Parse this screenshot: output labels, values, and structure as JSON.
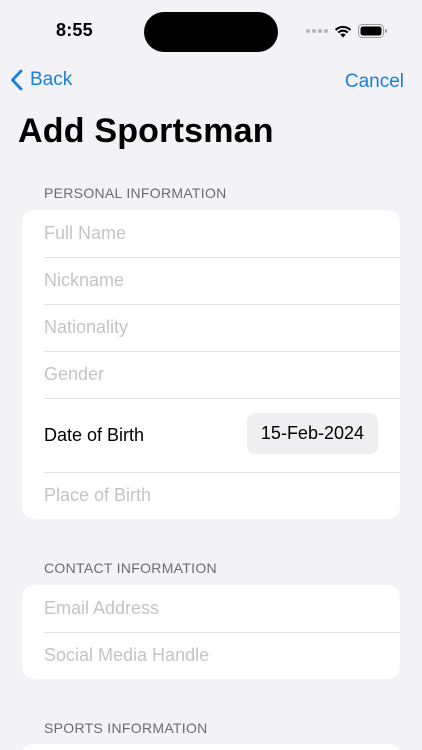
{
  "status_bar": {
    "time": "8:55",
    "icons": [
      "signal-dots-icon",
      "wifi-icon",
      "battery-icon"
    ]
  },
  "nav": {
    "back_label": "Back",
    "back_icon": "chevron-left-icon",
    "cancel_label": "Cancel",
    "accent_color": "#1a7fe0"
  },
  "title": "Add Sportsman",
  "personal": {
    "header": "PERSONAL INFORMATION",
    "full_name_placeholder": "Full Name",
    "nickname_placeholder": "Nickname",
    "nationality_placeholder": "Nationality",
    "gender_placeholder": "Gender",
    "dob_label": "Date of Birth",
    "dob_value": "15-Feb-2024",
    "pob_placeholder": "Place of Birth"
  },
  "contact": {
    "header": "CONTACT INFORMATION",
    "email_placeholder": "Email Address",
    "social_placeholder": "Social Media Handle"
  },
  "sports": {
    "header": "SPORTS INFORMATION"
  }
}
